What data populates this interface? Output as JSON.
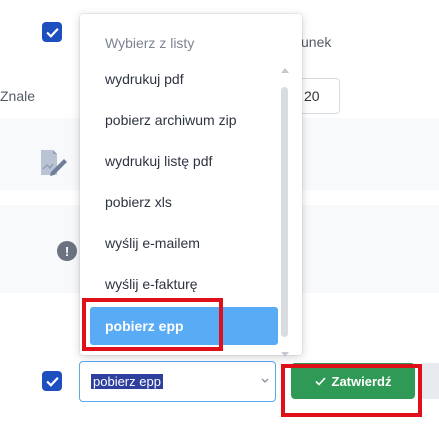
{
  "background": {
    "header_suffix": "unek",
    "found_label": "Znale",
    "page_size_value": "20"
  },
  "dropdown": {
    "title": "Wybierz z listy",
    "options": [
      "wydrukuj pdf",
      "pobierz archiwum zip",
      "wydrukuj listę pdf",
      "pobierz xls",
      "wyślij e-mailem",
      "wyślij e-fakturę",
      "pobierz epp"
    ],
    "selected": "pobierz epp"
  },
  "bulk_action": {
    "select_value": "pobierz epp",
    "confirm_label": "Zatwierdź"
  },
  "colors": {
    "accent_blue": "#5aabf5",
    "checkbox_blue": "#1e4fbf",
    "confirm_green": "#2f9a55",
    "highlight_red": "#e0101a"
  },
  "icons": {
    "check": "check-icon",
    "info": "info-icon",
    "document": "document-edit-icon",
    "chevron": "chevron-down-icon"
  }
}
